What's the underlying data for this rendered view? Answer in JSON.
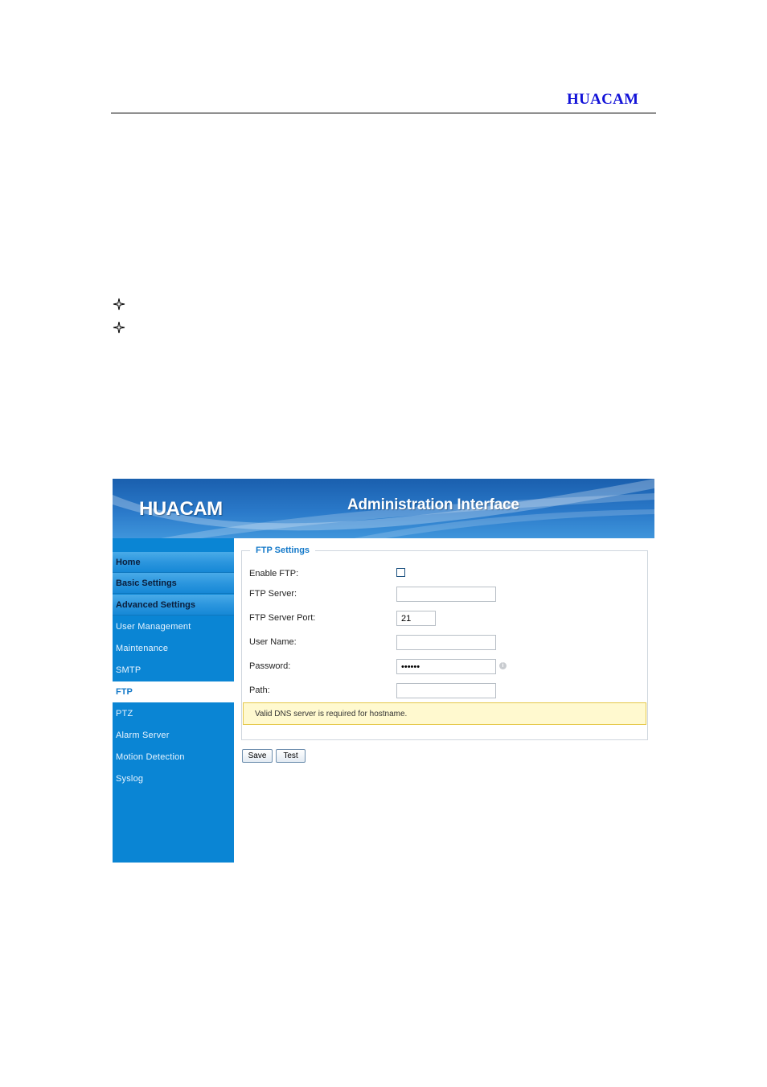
{
  "page": {
    "brand": "HUACAM"
  },
  "app": {
    "logo": "HUACAM",
    "title": "Administration Interface"
  },
  "sidebar": {
    "items": [
      {
        "label": "Home",
        "kind": "section"
      },
      {
        "label": "Basic Settings",
        "kind": "section"
      },
      {
        "label": "Advanced Settings",
        "kind": "section"
      },
      {
        "label": "User Management",
        "kind": "sub"
      },
      {
        "label": "Maintenance",
        "kind": "sub"
      },
      {
        "label": "SMTP",
        "kind": "sub"
      },
      {
        "label": "FTP",
        "kind": "active"
      },
      {
        "label": "PTZ",
        "kind": "sub"
      },
      {
        "label": "Alarm Server",
        "kind": "sub"
      },
      {
        "label": "Motion Detection",
        "kind": "sub"
      },
      {
        "label": "Syslog",
        "kind": "sub"
      }
    ]
  },
  "form": {
    "legend": "FTP Settings",
    "enable_label": "Enable FTP:",
    "enable_checked": false,
    "server_label": "FTP Server:",
    "server_value": "",
    "port_label": "FTP Server Port:",
    "port_value": "21",
    "username_label": "User Name:",
    "username_value": "",
    "password_label": "Password:",
    "password_value": "123456",
    "path_label": "Path:",
    "path_value": "",
    "notice": "Valid DNS server is required for hostname."
  },
  "buttons": {
    "save": "Save",
    "test": "Test"
  },
  "colors": {
    "brand_text": "#1212d8",
    "sidebar": "#0a85d4",
    "active_nav_text": "#1479c9",
    "notice_bg": "#fff9cf"
  }
}
